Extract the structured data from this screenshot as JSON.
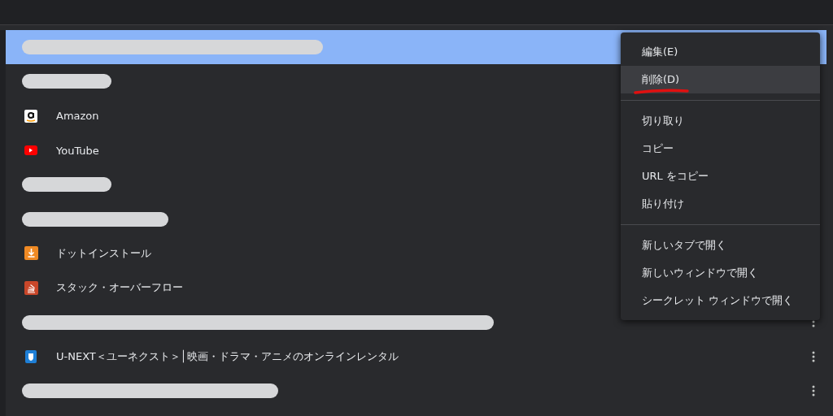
{
  "bookmarks": [
    {
      "kind": "redacted",
      "selected": true
    },
    {
      "kind": "redacted",
      "selected": false
    },
    {
      "kind": "bookmark",
      "title": "Amazon",
      "selected": false
    },
    {
      "kind": "bookmark",
      "title": "YouTube",
      "selected": false
    },
    {
      "kind": "redacted",
      "selected": false
    },
    {
      "kind": "redacted",
      "selected": false
    },
    {
      "kind": "bookmark",
      "title": "ドットインストール",
      "selected": false
    },
    {
      "kind": "bookmark",
      "title": "スタック・オーバーフロー",
      "selected": false
    },
    {
      "kind": "redacted",
      "selected": false
    },
    {
      "kind": "bookmark",
      "title": "U-NEXT＜ユーネクスト＞│映画・ドラマ・アニメのオンラインレンタル",
      "selected": false
    },
    {
      "kind": "redacted",
      "selected": false
    }
  ],
  "context_menu": {
    "groups": [
      [
        {
          "label": "編集(E)",
          "selected": false
        },
        {
          "label": "削除(D)",
          "selected": true
        }
      ],
      [
        {
          "label": "切り取り",
          "selected": false
        },
        {
          "label": "コピー",
          "selected": false
        },
        {
          "label": "URL をコピー",
          "selected": false
        },
        {
          "label": "貼り付け",
          "selected": false
        }
      ],
      [
        {
          "label": "新しいタブで開く",
          "selected": false
        },
        {
          "label": "新しいウィンドウで開く",
          "selected": false
        },
        {
          "label": "シークレット ウィンドウで開く",
          "selected": false
        }
      ]
    ]
  }
}
